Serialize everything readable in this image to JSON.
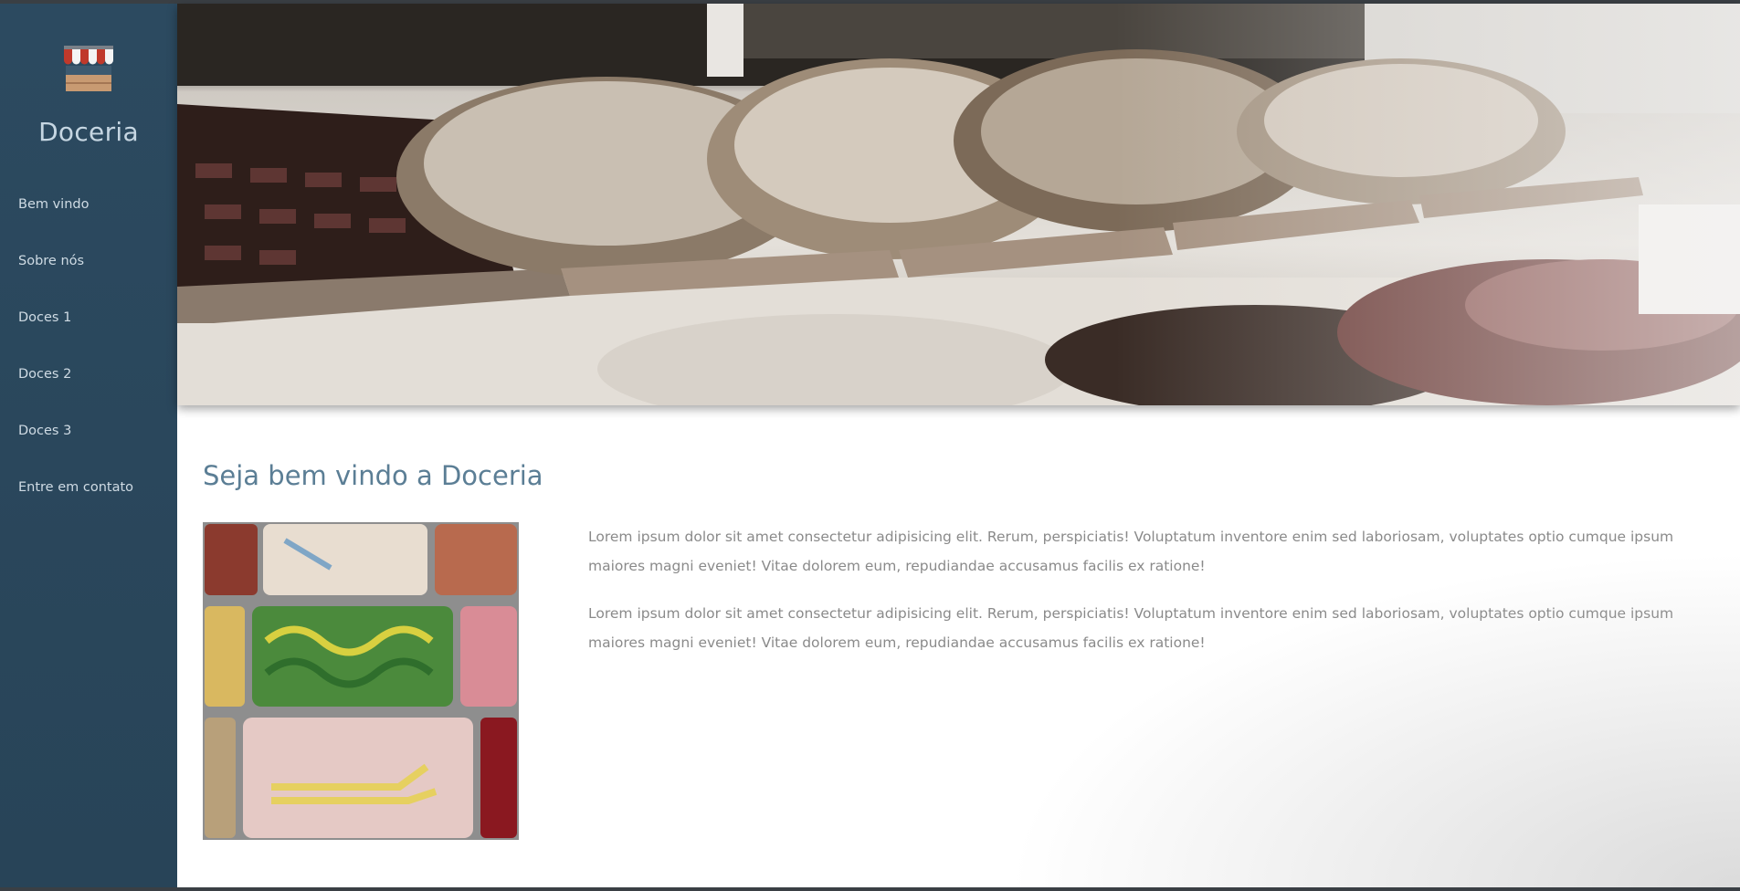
{
  "site": {
    "brand": "Doceria",
    "logo_icon": "shop-awning-icon"
  },
  "sidebar": {
    "items": [
      {
        "label": "Bem vindo"
      },
      {
        "label": "Sobre nós"
      },
      {
        "label": "Doces 1"
      },
      {
        "label": "Doces 2"
      },
      {
        "label": "Doces 3"
      },
      {
        "label": "Entre em contato"
      }
    ]
  },
  "main": {
    "heading": "Seja bem vindo a Doceria",
    "paragraphs": [
      "Lorem ipsum dolor sit amet consectetur adipisicing elit. Rerum, perspiciatis! Voluptatum inventore enim sed laboriosam, voluptates optio cumque ipsum maiores magni eveniet! Vitae dolorem eum, repudiandae accusamus facilis ex ratione!",
      "Lorem ipsum dolor sit amet consectetur adipisicing elit. Rerum, perspiciatis! Voluptatum inventore enim sed laboriosam, voluptates optio cumque ipsum maiores magni eveniet! Vitae dolorem eum, repudiandae accusamus facilis ex ratione!"
    ]
  },
  "colors": {
    "sidebar_bg": "#2c4a60",
    "heading": "#5b7e95",
    "body_text": "#8a8a8a"
  }
}
